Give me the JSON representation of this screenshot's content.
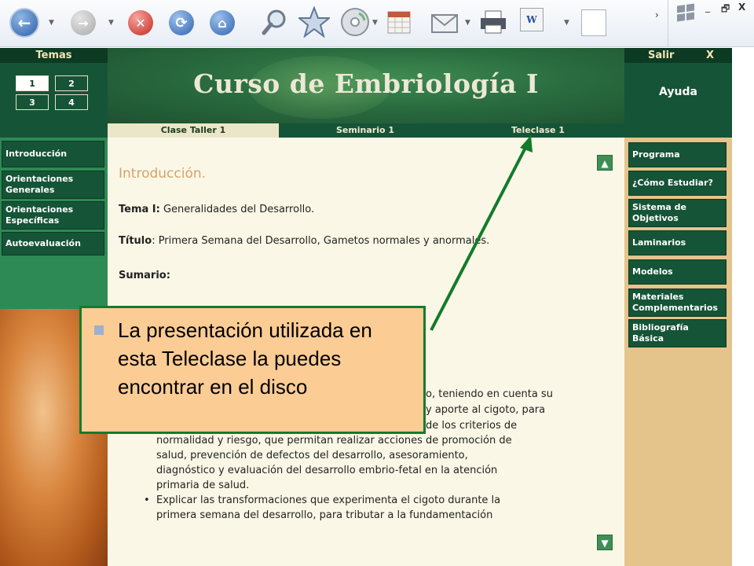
{
  "browser": {
    "buttons": [
      {
        "name": "back-button",
        "glyph": "←"
      },
      {
        "name": "forward-button",
        "glyph": "→"
      },
      {
        "name": "stop-button",
        "glyph": "✕"
      },
      {
        "name": "refresh-button",
        "glyph": "⟳"
      },
      {
        "name": "home-button",
        "glyph": "⌂"
      },
      {
        "name": "search-button",
        "glyph": "🔍"
      },
      {
        "name": "favorites-button",
        "glyph": "★"
      },
      {
        "name": "media-button",
        "glyph": "◉"
      },
      {
        "name": "history-button",
        "glyph": "▦"
      },
      {
        "name": "mail-button",
        "glyph": "✉"
      },
      {
        "name": "print-button",
        "glyph": "⎙"
      }
    ],
    "edit_glyph": "W",
    "more_glyph": "›",
    "window_controls": {
      "minimize": "_",
      "maximize": "🗗",
      "close": "X"
    }
  },
  "header": {
    "temas_label": "Temas",
    "temas": [
      "1",
      "2",
      "3",
      "4"
    ],
    "title": "Curso de Embriología I",
    "salir_label": "Salir",
    "salir_x": "X",
    "ayuda_label": "Ayuda"
  },
  "tabs": [
    {
      "label": "Clase Taller 1"
    },
    {
      "label": "Seminario 1"
    },
    {
      "label": "Teleclase 1"
    }
  ],
  "left_nav": [
    {
      "label": "Introducción"
    },
    {
      "label": "Orientaciones Generales"
    },
    {
      "label": "Orientaciones Específicas"
    },
    {
      "label": "Autoevaluación"
    }
  ],
  "right_nav": [
    {
      "label": "Programa"
    },
    {
      "label": "¿Cómo Estudiar?"
    },
    {
      "label": "Sistema de Objetivos"
    },
    {
      "label": "Laminarios"
    },
    {
      "label": "Modelos"
    },
    {
      "label": "Materiales Complementarios"
    },
    {
      "label": "Bibliografía Básica"
    }
  ],
  "content": {
    "heading": "Introducción.",
    "tema_label": "Tema I:",
    "tema_value": " Generalidades del Desarrollo.",
    "titulo_label": "Título",
    "titulo_value": ": Primera Semana del Desarrollo, Gametos normales y anormales.",
    "sumario_label": "Sumario:",
    "partial_lines": [
      "o, teniendo en cuenta su",
      "y aporte al cigoto, para",
      "de los criterios de"
    ],
    "bullets": [
      {
        "lines": [
          "normalidad y riesgo, que permitan realizar acciones de promoción de",
          "salud, prevención de defectos del desarrollo, asesoramiento,",
          "diagnóstico y evaluación del desarrollo embrio-fetal en la atención",
          "primaria de salud."
        ],
        "bulleted": false
      },
      {
        "lines": [
          "Explicar las transformaciones que experimenta el cigoto durante la",
          "primera semana del desarrollo, para tributar a la fundamentación"
        ],
        "bulleted": true
      }
    ],
    "bullet_glyph": "•",
    "scroll_up": "▲",
    "scroll_down": "▼"
  },
  "callout": {
    "text": "La presentación utilizada en esta Teleclase la puedes encontrar en el disco"
  },
  "colors": {
    "dark_green": "#155437",
    "callout_fill": "#fccc95",
    "callout_border": "#117c2a",
    "arrow": "#117c2a"
  }
}
